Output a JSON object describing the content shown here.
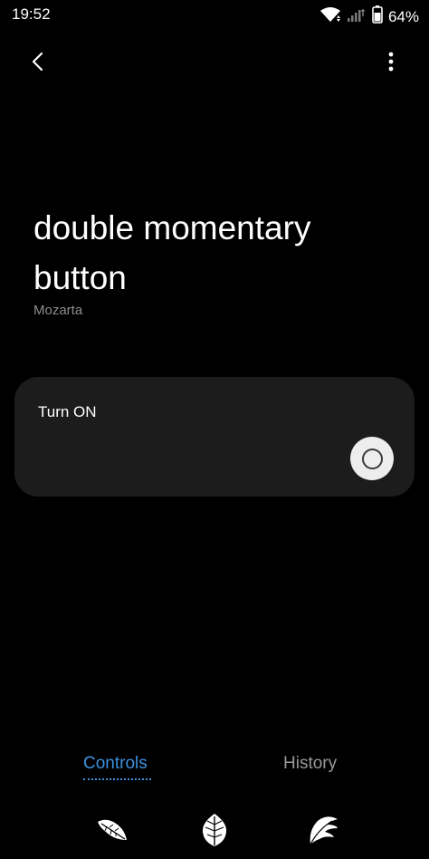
{
  "status_bar": {
    "time": "19:52",
    "battery": "64%",
    "icons": [
      "wifi-icon",
      "signal-icon",
      "battery-icon"
    ]
  },
  "header": {
    "back_icon": "chevron-left-icon",
    "more_icon": "more-vertical-icon"
  },
  "device": {
    "title": "double momentary button",
    "subtitle": "Mozarta"
  },
  "control": {
    "label": "Turn ON",
    "state": "off",
    "icon": "power-ring-icon"
  },
  "tabs": [
    {
      "label": "Controls",
      "selected": true
    },
    {
      "label": "History",
      "selected": false
    }
  ],
  "nav": {
    "icons": [
      "leaf-recent-icon",
      "leaf-home-icon",
      "leaf-back-icon"
    ]
  },
  "colors": {
    "background": "#000000",
    "card": "#1c1c1c",
    "accent": "#3e91e0",
    "muted_text": "#8e8e8e"
  }
}
